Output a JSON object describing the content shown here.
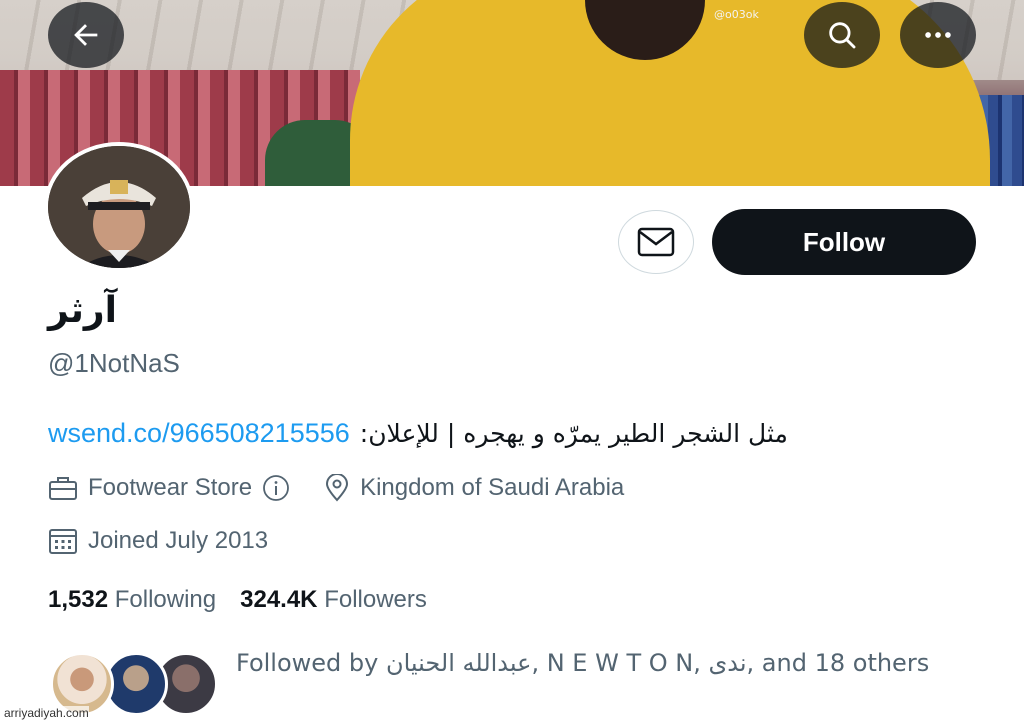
{
  "banner": {
    "watermark": "@o03ok"
  },
  "header": {
    "back_icon": "arrow-left-icon",
    "search_icon": "search-icon",
    "more_icon": "more-horizontal-icon"
  },
  "actions": {
    "message_icon": "envelope-icon",
    "follow_label": "Follow"
  },
  "profile": {
    "display_name": "آرثر",
    "handle": "@1NotNaS",
    "bio_link": "wsend.co/966508215556",
    "bio_text": "مثل الشجر الطير يمرّه و يهجره | للإعلان:",
    "category": "Footwear Store",
    "location": "Kingdom of Saudi Arabia",
    "joined": "Joined July 2013"
  },
  "stats": {
    "following_count": "1,532",
    "following_label": "Following",
    "followers_count": "324.4K",
    "followers_label": "Followers"
  },
  "followed_by": {
    "text": "Followed by عبدالله الحنيان, N E W T O N, ندى, and 18 others"
  },
  "site_watermark": "arriyadiyah.com",
  "colors": {
    "link": "#1d9bf0",
    "secondary_text": "#536471",
    "primary_text": "#0f1419",
    "follow_button_bg": "#0f1419"
  }
}
